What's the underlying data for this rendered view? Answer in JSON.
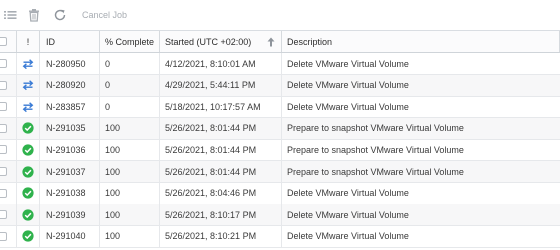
{
  "toolbar": {
    "cancel_label": "Cancel Job"
  },
  "columns": {
    "status": "!",
    "id": "ID",
    "percent": "% Complete",
    "started": "Started (UTC +02:00)",
    "description": "Description"
  },
  "sort": {
    "column": "started",
    "direction": "ascending"
  },
  "colors": {
    "running": "#3a7bd5",
    "done": "#2fb24c"
  },
  "rows": [
    {
      "status": "running",
      "id": "N-280950",
      "percent": "0",
      "started": "4/12/2021, 8:10:01 AM",
      "description": "Delete VMware Virtual Volume"
    },
    {
      "status": "running",
      "id": "N-280920",
      "percent": "0",
      "started": "4/29/2021, 5:44:11 PM",
      "description": "Delete VMware Virtual Volume"
    },
    {
      "status": "running",
      "id": "N-283857",
      "percent": "0",
      "started": "5/18/2021, 10:17:57 AM",
      "description": "Delete VMware Virtual Volume"
    },
    {
      "status": "done",
      "id": "N-291035",
      "percent": "100",
      "started": "5/26/2021, 8:01:44 PM",
      "description": "Prepare to snapshot VMware Virtual Volume"
    },
    {
      "status": "done",
      "id": "N-291036",
      "percent": "100",
      "started": "5/26/2021, 8:01:44 PM",
      "description": "Prepare to snapshot VMware Virtual Volume"
    },
    {
      "status": "done",
      "id": "N-291037",
      "percent": "100",
      "started": "5/26/2021, 8:01:44 PM",
      "description": "Prepare to snapshot VMware Virtual Volume"
    },
    {
      "status": "done",
      "id": "N-291038",
      "percent": "100",
      "started": "5/26/2021, 8:04:46 PM",
      "description": "Delete VMware Virtual Volume"
    },
    {
      "status": "done",
      "id": "N-291039",
      "percent": "100",
      "started": "5/26/2021, 8:10:17 PM",
      "description": "Delete VMware Virtual Volume"
    },
    {
      "status": "done",
      "id": "N-291040",
      "percent": "100",
      "started": "5/26/2021, 8:10:21 PM",
      "description": "Delete VMware Virtual Volume"
    }
  ]
}
